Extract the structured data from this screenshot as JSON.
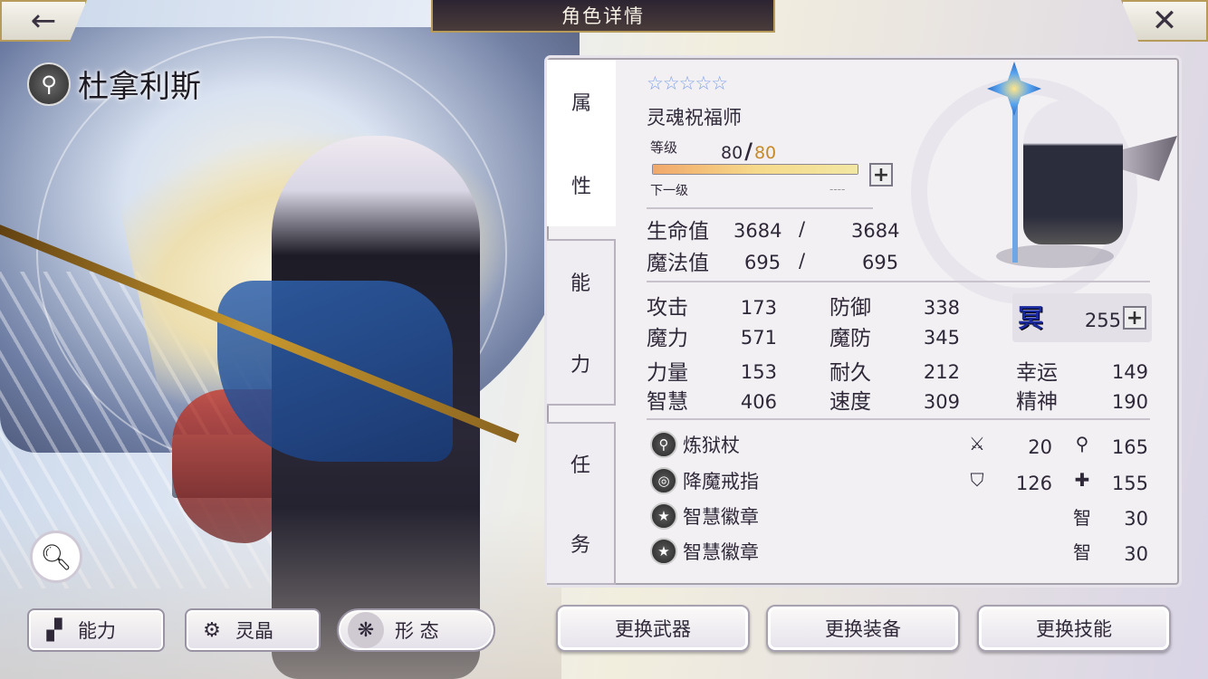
{
  "header": {
    "title": "角色详情",
    "back_icon": "←",
    "close_icon": "✕"
  },
  "character": {
    "name": "杜拿利斯",
    "weapon_type_icon": "staff-icon"
  },
  "tabs": [
    {
      "label_top": "属",
      "label_bottom": "性",
      "active": true
    },
    {
      "label_top": "能",
      "label_bottom": "力",
      "active": false
    },
    {
      "label_top": "任",
      "label_bottom": "务",
      "active": false
    }
  ],
  "profile": {
    "stars": "☆☆☆☆☆",
    "star_count": 5,
    "job": "灵魂祝福师",
    "level_label": "等级",
    "level": "80",
    "level_sep": "/",
    "level_max": "80",
    "exp_fraction": 1.0,
    "next_label": "下一级",
    "next_value": "----"
  },
  "vitals": {
    "hp_label": "生命值",
    "hp": "3684",
    "hp_max": "3684",
    "mp_label": "魔法值",
    "mp": "695",
    "mp_max": "695",
    "sep": "/"
  },
  "stats": {
    "atk_label": "攻击",
    "atk": "173",
    "def_label": "防御",
    "def": "338",
    "mag_label": "魔力",
    "mag": "571",
    "spr_label": "魔防",
    "spr": "345",
    "str_label": "力量",
    "str": "153",
    "vit_label": "耐久",
    "vit": "212",
    "luck_label": "幸运",
    "luck": "149",
    "int_label": "智慧",
    "int": "406",
    "spd_label": "速度",
    "spd": "309",
    "mind_label": "精神",
    "mind": "190",
    "special_mark": "冥",
    "special_value": "255"
  },
  "equipment": [
    {
      "name": "炼狱杖",
      "icon": "staff-icon",
      "stat1_icon": "sword-icon",
      "stat1_glyph": "⚔",
      "stat1": "20",
      "stat2_icon": "staff-small-icon",
      "stat2_glyph": "⚲",
      "stat2": "165"
    },
    {
      "name": "降魔戒指",
      "icon": "ring-icon",
      "stat1_icon": "shield-icon",
      "stat1_glyph": "⛉",
      "stat1": "126",
      "stat2_icon": "cross-shield-icon",
      "stat2_glyph": "✚",
      "stat2": "155"
    },
    {
      "name": "智慧徽章",
      "icon": "badge-icon",
      "stat_label": "智",
      "stat": "30"
    },
    {
      "name": "智慧徽章",
      "icon": "badge-icon",
      "stat_label": "智",
      "stat": "30"
    }
  ],
  "bottom_left": {
    "ability": "能力",
    "crystal": "灵晶",
    "form": "形 态"
  },
  "actions": {
    "weapon": "更换武器",
    "gear": "更换装备",
    "skill": "更换技能"
  },
  "colors": {
    "level_max": "#c7882a",
    "stars": "#7ea2e6",
    "special": "#1a2a9c",
    "gold_border": "#b79b5a"
  }
}
